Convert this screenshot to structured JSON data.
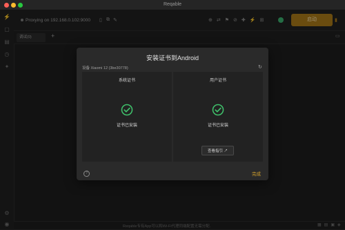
{
  "window": {
    "title": "Reqable"
  },
  "toolbar": {
    "proxy_status": "Proxying on 192.168.0.102:9000",
    "start_label": "启动"
  },
  "tabs": [
    {
      "label": "调试(0)"
    }
  ],
  "status": {
    "message": "Reqable专有App可以和Wi-Fi代理同端配置无需分配."
  },
  "dialog": {
    "title": "安装证书到Android",
    "device_label": "设备",
    "device_name": "Xiaomi 12 (3be30778)",
    "system_cert": {
      "heading": "系统证书",
      "state": "证书已安装"
    },
    "user_cert": {
      "heading": "用户证书",
      "state": "证书已安装",
      "guide_button": "查看指引"
    },
    "help_label": "?",
    "done_label": "完成"
  },
  "colors": {
    "accent": "#a37618",
    "success": "#3fbf6a",
    "done": "#d4a22c"
  }
}
